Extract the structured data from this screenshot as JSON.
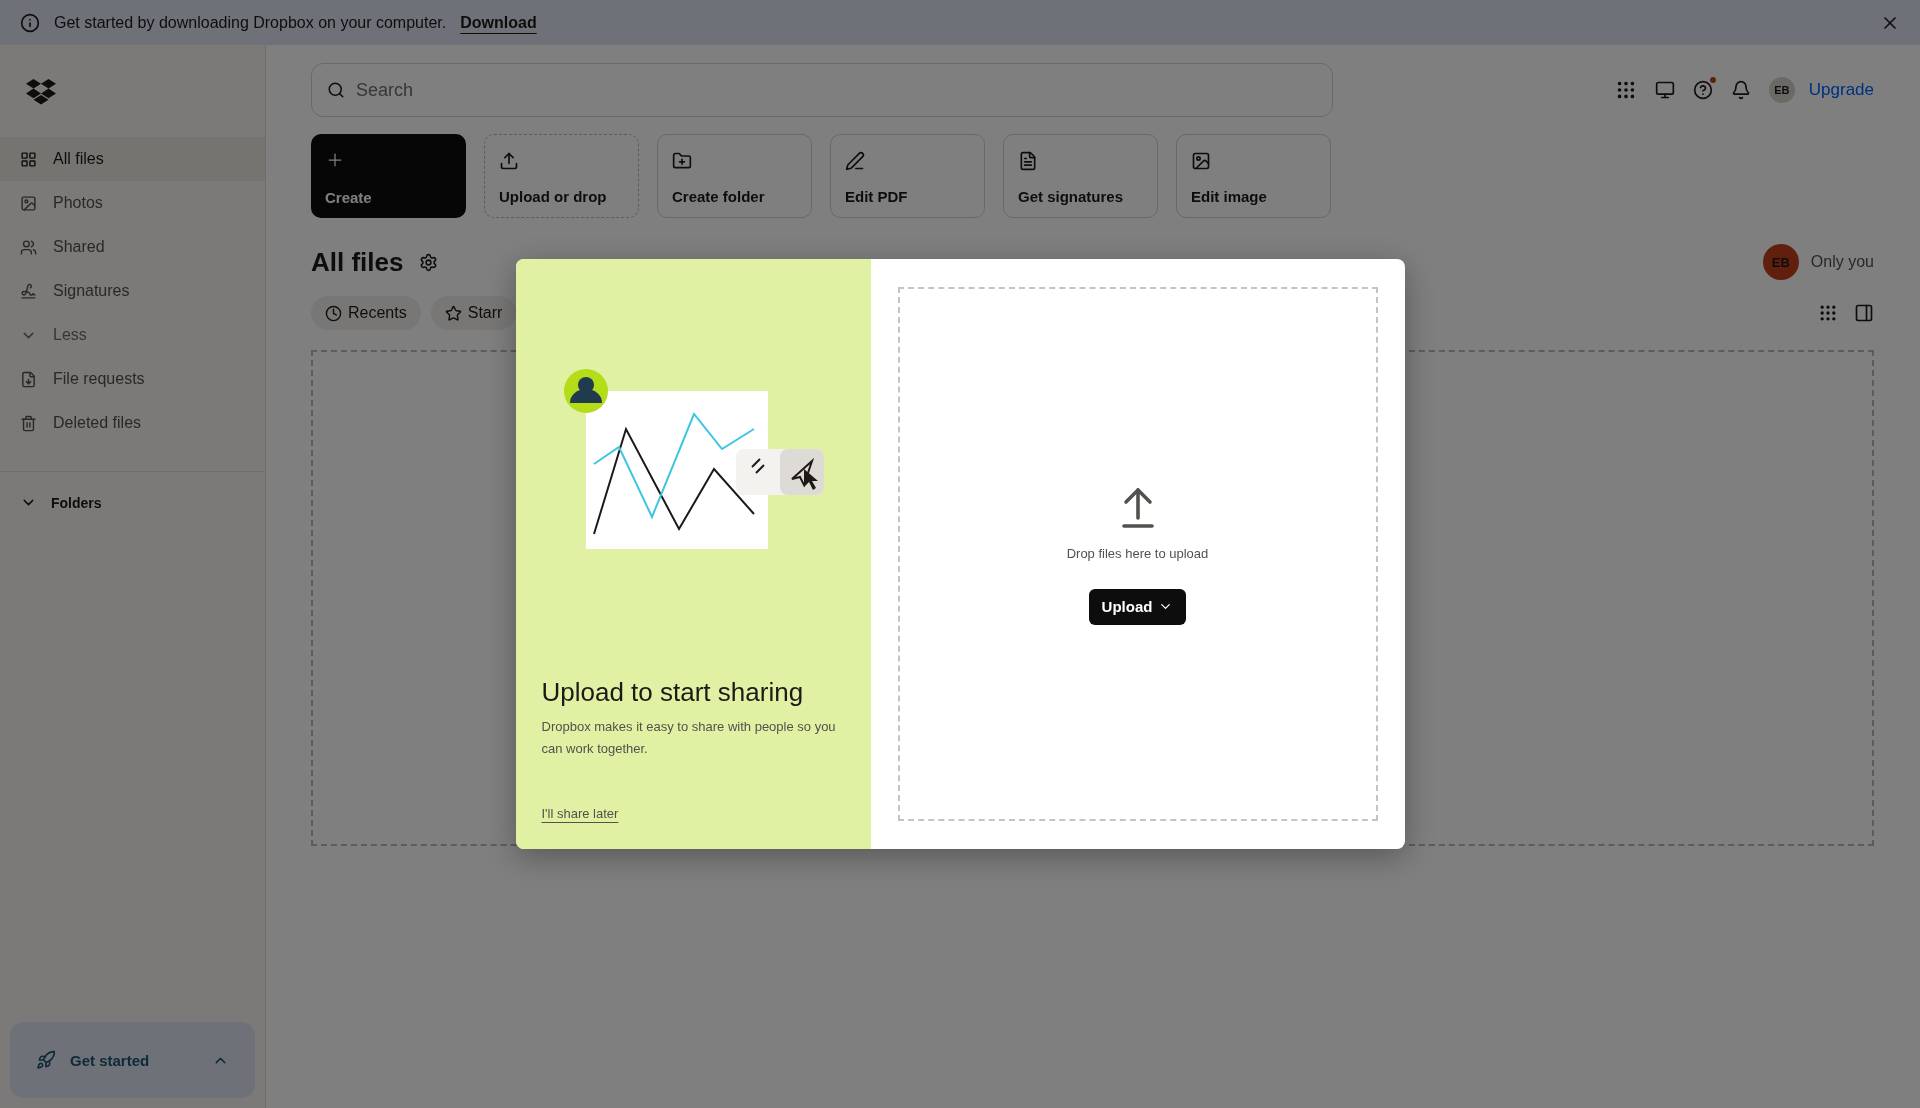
{
  "banner": {
    "text": "Get started by downloading Dropbox on your computer.",
    "link": "Download"
  },
  "sidebar": {
    "items": [
      {
        "label": "All files",
        "kind": "link",
        "selected": true
      },
      {
        "label": "Photos",
        "kind": "link",
        "selected": false
      },
      {
        "label": "Shared",
        "kind": "link",
        "selected": false
      },
      {
        "label": "Signatures",
        "kind": "link",
        "selected": false
      },
      {
        "label": "Less",
        "kind": "toggle",
        "selected": false
      },
      {
        "label": "File requests",
        "kind": "link",
        "selected": false
      },
      {
        "label": "Deleted files",
        "kind": "link",
        "selected": false
      }
    ],
    "section": {
      "label": "Folders",
      "expanded": true
    },
    "get_started": {
      "label": "Get started",
      "expanded": false
    }
  },
  "search": {
    "placeholder": "Search"
  },
  "header": {
    "avatar": "EB",
    "upgrade": "Upgrade"
  },
  "actions": [
    {
      "label": "Create",
      "kind": "primary"
    },
    {
      "label": "Upload or drop",
      "kind": "dashed"
    },
    {
      "label": "Create folder",
      "kind": "outline"
    },
    {
      "label": "Edit PDF",
      "kind": "outline"
    },
    {
      "label": "Get signatures",
      "kind": "outline"
    },
    {
      "label": "Edit image",
      "kind": "outline"
    }
  ],
  "page": {
    "title": "All files",
    "owner_avatar": "EB",
    "owner": "Only you"
  },
  "chips": [
    "Recents",
    "Starr"
  ],
  "modal": {
    "title": "Upload to start sharing",
    "body": "Dropbox makes it easy to share with people so you can work together.",
    "link": "I'll share later",
    "drop_text": "Drop files here to upload",
    "upload_button": "Upload"
  }
}
